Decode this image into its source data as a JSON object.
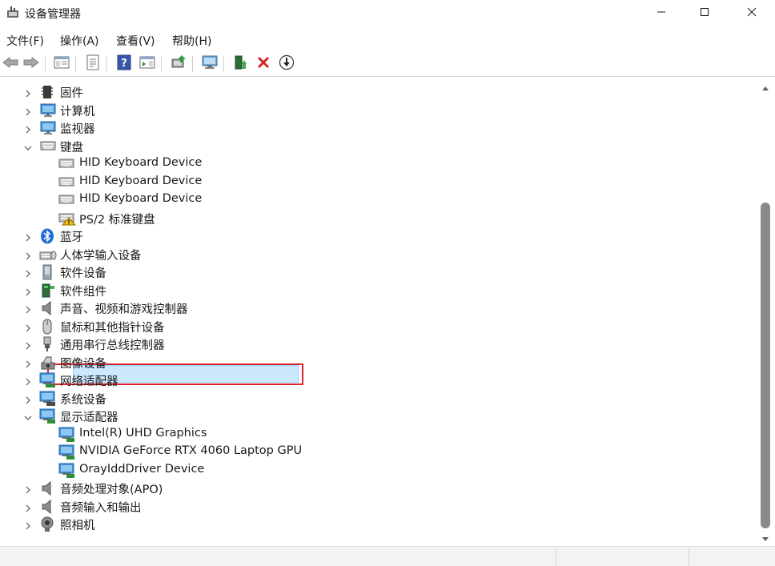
{
  "window": {
    "title": "设备管理器",
    "icon": "device-manager-icon",
    "controls": {
      "minimize": "minimize-icon",
      "maximize": "maximize-icon",
      "close": "close-icon"
    }
  },
  "menu": {
    "items": [
      {
        "label": "文件(F)"
      },
      {
        "label": "操作(A)"
      },
      {
        "label": "查看(V)"
      },
      {
        "label": "帮助(H)"
      }
    ]
  },
  "toolbar": {
    "buttons": [
      "back-icon",
      "forward-icon",
      "show-hide-tree-icon",
      "properties-icon",
      "help-icon",
      "action-pane-icon",
      "update-driver-icon",
      "scan-hardware-icon",
      "enable-device-icon",
      "uninstall-device-icon",
      "download-icon"
    ]
  },
  "tree": {
    "items": [
      {
        "label": "固件",
        "expanded": false,
        "icon": "firmware-icon"
      },
      {
        "label": "计算机",
        "expanded": false,
        "icon": "computer-icon"
      },
      {
        "label": "监视器",
        "expanded": false,
        "icon": "monitor-icon"
      },
      {
        "label": "键盘",
        "expanded": true,
        "icon": "keyboard-icon",
        "children": [
          {
            "label": "HID Keyboard Device",
            "icon": "keyboard-icon"
          },
          {
            "label": "HID Keyboard Device",
            "icon": "keyboard-icon"
          },
          {
            "label": "HID Keyboard Device",
            "icon": "keyboard-icon"
          },
          {
            "label": "PS/2 标准键盘",
            "icon": "keyboard-warning-icon"
          }
        ]
      },
      {
        "label": "蓝牙",
        "expanded": false,
        "icon": "bluetooth-icon"
      },
      {
        "label": "人体学输入设备",
        "expanded": false,
        "icon": "hid-icon"
      },
      {
        "label": "软件设备",
        "expanded": false,
        "icon": "software-device-icon"
      },
      {
        "label": "软件组件",
        "expanded": false,
        "icon": "software-component-icon"
      },
      {
        "label": "声音、视频和游戏控制器",
        "expanded": false,
        "icon": "speaker-icon"
      },
      {
        "label": "鼠标和其他指针设备",
        "expanded": false,
        "icon": "mouse-icon"
      },
      {
        "label": "通用串行总线控制器",
        "expanded": false,
        "icon": "usb-icon"
      },
      {
        "label": "图像设备",
        "expanded": false,
        "icon": "camera-icon"
      },
      {
        "label": "网络适配器",
        "expanded": false,
        "icon": "network-adapter-icon"
      },
      {
        "label": "系统设备",
        "expanded": false,
        "icon": "system-device-icon"
      },
      {
        "label": "显示适配器",
        "expanded": true,
        "icon": "display-adapter-icon",
        "children": [
          {
            "label": "Intel(R) UHD Graphics",
            "icon": "display-adapter-icon"
          },
          {
            "label": "NVIDIA GeForce RTX 4060 Laptop GPU",
            "icon": "display-adapter-icon",
            "selected": true
          },
          {
            "label": "OrayIddDriver Device",
            "icon": "display-adapter-icon"
          }
        ]
      },
      {
        "label": "音频处理对象(APO)",
        "expanded": false,
        "icon": "speaker-icon"
      },
      {
        "label": "音频输入和输出",
        "expanded": false,
        "icon": "speaker-icon"
      },
      {
        "label": "照相机",
        "expanded": false,
        "icon": "webcam-icon"
      }
    ]
  },
  "colors": {
    "selection_bg": "#cce8ff",
    "selection_border": "#99d1ff",
    "highlight_outline": "#d9232d"
  }
}
